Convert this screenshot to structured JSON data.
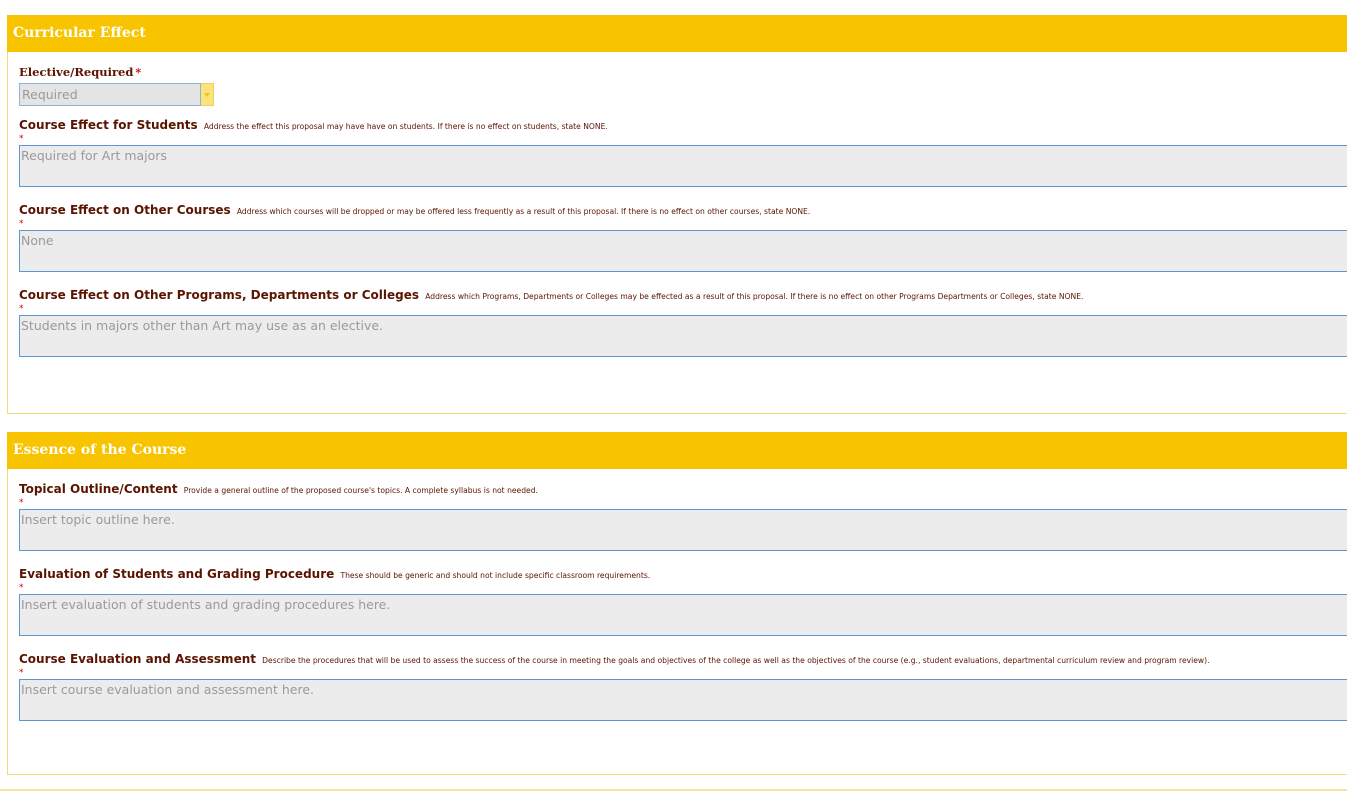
{
  "sections": [
    {
      "title": "Curricular Effect",
      "elective": {
        "label": "Elective/Required",
        "star": "*",
        "value": "Required"
      },
      "fields": [
        {
          "label": "Course Effect for Students",
          "hint": "Address the effect this proposal may have have on students. If there is no effect on students, state NONE.",
          "star": "*",
          "value": "Required for Art majors"
        },
        {
          "label": "Course Effect on Other Courses",
          "hint": "Address which courses will be dropped or may be offered less frequently as a result of this proposal. If there is no effect on other courses, state NONE.",
          "star": "*",
          "value": "None"
        },
        {
          "label": "Course Effect on Other Programs, Departments or Colleges",
          "hint": "Address which Programs, Departments or Colleges may be effected as a result of this proposal. If there is no effect on other Programs Departments or Colleges, state NONE.",
          "star": "*",
          "value": "Students in majors other than Art may use as an elective."
        }
      ]
    },
    {
      "title": "Essence of the Course",
      "fields": [
        {
          "label": "Topical Outline/Content",
          "hint": "Provide a general outline of the proposed course's topics. A complete syllabus is not needed.",
          "star": "*",
          "value": "Insert topic outline here."
        },
        {
          "label": "Evaluation of Students and Grading Procedure",
          "hint": "These should be generic and should not include specific classroom requirements.",
          "star": "*",
          "value": "Insert evaluation of students and grading procedures here."
        },
        {
          "label": "Course Evaluation and Assessment",
          "hint": "Describe the procedures that will be used to assess the success of the course in meeting the goals and objectives of the college as well as the objectives of the course (e.g., student evaluations, departmental curriculum review and program review).",
          "star": "*",
          "value": "Insert course evaluation and assessment here."
        }
      ]
    }
  ]
}
